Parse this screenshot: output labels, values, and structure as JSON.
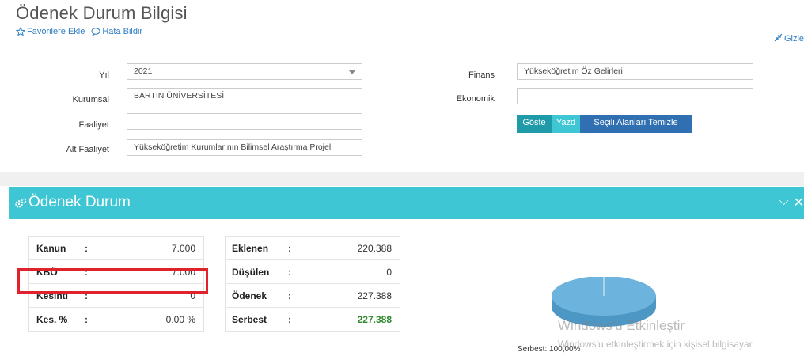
{
  "page": {
    "title": "Ödenek Durum Bilgisi",
    "favorites_label": "Favorilere Ekle",
    "report_label": "Hata Bildir",
    "hide_label": "Gizle"
  },
  "form": {
    "yil": {
      "label": "Yıl",
      "value": "2021"
    },
    "kurumsal": {
      "label": "Kurumsal",
      "value": "BARTIN ÜNİVERSİTESİ"
    },
    "faaliyet": {
      "label": "Faaliyet",
      "value": ""
    },
    "alt_faaliyet": {
      "label": "Alt Faaliyet",
      "value": "Yükseköğretim Kurumlarının Bilimsel Araştırma Projel"
    },
    "finans": {
      "label": "Finans",
      "value": "Yükseköğretim Öz Gelirleri"
    },
    "ekonomik": {
      "label": "Ekonomik",
      "value": ""
    },
    "buttons": {
      "goster": "Göste",
      "yazdir": "Yazd",
      "temizle": "Seçili Alanları Temizle"
    }
  },
  "panel": {
    "title": "Ödenek Durum",
    "tools": [
      "⌵",
      "✕"
    ]
  },
  "left_table": [
    {
      "label": "Kanun",
      "colon": ":",
      "value": "7.000"
    },
    {
      "label": "KBÖ",
      "colon": ":",
      "value": "7.000"
    },
    {
      "label": "Kesinti",
      "colon": ":",
      "value": "0"
    },
    {
      "label": "Kes. %",
      "colon": ":",
      "value": "0,00 %"
    }
  ],
  "right_table": [
    {
      "label": "Eklenen",
      "colon": ":",
      "value": "220.388"
    },
    {
      "label": "Düşülen",
      "colon": ":",
      "value": "0"
    },
    {
      "label": "Ödenek",
      "colon": ":",
      "value": "227.388"
    },
    {
      "label": "Serbest",
      "colon": ":",
      "value": "227.388"
    }
  ],
  "pie": {
    "label": "Serbest: 100,00%",
    "color": "#6cb4de"
  },
  "watermark": {
    "line1": "Windows'u Etkinleştir",
    "line2": "Windows'u etkinleştirmek için kişisel bilgisayar"
  },
  "colors": {
    "panel_header": "#3ec6d4",
    "btn_show": "#1f9aa8",
    "btn_print": "#3ec6d4",
    "btn_clear": "#2f6fb2",
    "highlight": "#e0222c",
    "green_value": "#2e8b2e"
  }
}
